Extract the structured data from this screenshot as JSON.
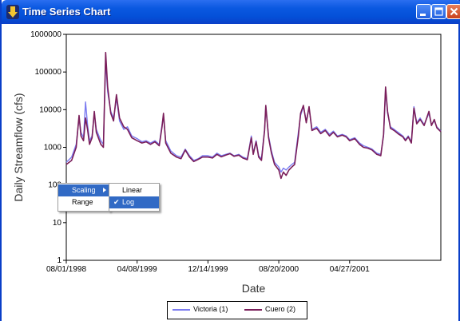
{
  "window": {
    "title": "Time Series Chart"
  },
  "icons": [
    "download-arrow-icon",
    "minimize-icon",
    "maximize-icon",
    "close-icon"
  ],
  "colors": {
    "titlebar": "#0a58e0",
    "victoria": "#7b7bf0",
    "cuero": "#7a1e5a",
    "menu_highlight": "#316ac5"
  },
  "context_menu": {
    "items": [
      {
        "label": "Scaling",
        "highlighted": true,
        "has_submenu": true
      },
      {
        "label": "Range",
        "highlighted": false
      }
    ],
    "submenu": {
      "items": [
        {
          "label": "Linear",
          "checked": false,
          "highlighted": false
        },
        {
          "label": "Log",
          "checked": true,
          "highlighted": true
        }
      ]
    }
  },
  "chart_data": {
    "type": "line",
    "xlabel": "Date",
    "ylabel": "Daily Streamflow (cfs)",
    "yscale": "log",
    "ylim": [
      1,
      1000000
    ],
    "y_ticks": [
      "1",
      "10",
      "100",
      "1000",
      "10000",
      "100000",
      "1000000"
    ],
    "x_ticks": [
      "08/01/1998",
      "04/08/1999",
      "12/14/1999",
      "08/20/2000",
      "04/27/2001"
    ],
    "x_range": [
      "1998-08-01",
      "2002-03-15"
    ],
    "legend_position": "bottom",
    "series": [
      {
        "name": "Victoria (1)",
        "color": "#7b7bf0",
        "points": [
          [
            "1998-08-01",
            400
          ],
          [
            "1998-08-20",
            550
          ],
          [
            "1998-09-05",
            1200
          ],
          [
            "1998-09-15",
            6000
          ],
          [
            "1998-09-22",
            2500
          ],
          [
            "1998-10-01",
            1800
          ],
          [
            "1998-10-08",
            16000
          ],
          [
            "1998-10-15",
            4000
          ],
          [
            "1998-10-22",
            1500
          ],
          [
            "1998-10-31",
            2000
          ],
          [
            "1998-11-08",
            8000
          ],
          [
            "1998-11-15",
            3000
          ],
          [
            "1998-12-01",
            1500
          ],
          [
            "1998-12-10",
            1200
          ],
          [
            "1998-12-18",
            200000
          ],
          [
            "1998-12-25",
            30000
          ],
          [
            "1999-01-05",
            9000
          ],
          [
            "1999-01-15",
            6000
          ],
          [
            "1999-01-25",
            20000
          ],
          [
            "1999-02-05",
            5000
          ],
          [
            "1999-02-20",
            3000
          ],
          [
            "1999-03-05",
            3500
          ],
          [
            "1999-03-20",
            2000
          ],
          [
            "1999-04-08",
            1700
          ],
          [
            "1999-04-25",
            1400
          ],
          [
            "1999-05-10",
            1500
          ],
          [
            "1999-05-25",
            1300
          ],
          [
            "1999-06-10",
            1500
          ],
          [
            "1999-06-25",
            1200
          ],
          [
            "1999-07-05",
            4000
          ],
          [
            "1999-07-10",
            7000
          ],
          [
            "1999-07-18",
            1500
          ],
          [
            "1999-08-05",
            800
          ],
          [
            "1999-08-25",
            600
          ],
          [
            "1999-09-10",
            550
          ],
          [
            "1999-09-25",
            900
          ],
          [
            "1999-10-10",
            600
          ],
          [
            "1999-10-25",
            450
          ],
          [
            "1999-11-10",
            500
          ],
          [
            "1999-11-25",
            600
          ],
          [
            "1999-12-14",
            600
          ],
          [
            "1999-12-30",
            550
          ],
          [
            "2000-01-15",
            700
          ],
          [
            "2000-01-30",
            600
          ],
          [
            "2000-02-15",
            650
          ],
          [
            "2000-03-01",
            700
          ],
          [
            "2000-03-15",
            600
          ],
          [
            "2000-04-01",
            650
          ],
          [
            "2000-04-15",
            550
          ],
          [
            "2000-05-01",
            500
          ],
          [
            "2000-05-15",
            2000
          ],
          [
            "2000-05-22",
            700
          ],
          [
            "2000-06-01",
            1500
          ],
          [
            "2000-06-10",
            600
          ],
          [
            "2000-06-20",
            500
          ],
          [
            "2000-07-01",
            3000
          ],
          [
            "2000-07-05",
            12000
          ],
          [
            "2000-07-15",
            2000
          ],
          [
            "2000-07-25",
            800
          ],
          [
            "2000-08-05",
            400
          ],
          [
            "2000-08-20",
            300
          ],
          [
            "2000-08-28",
            220
          ],
          [
            "2000-09-05",
            280
          ],
          [
            "2000-09-15",
            250
          ],
          [
            "2000-09-25",
            300
          ],
          [
            "2000-10-05",
            350
          ],
          [
            "2000-10-15",
            400
          ],
          [
            "2000-10-28",
            2500
          ],
          [
            "2000-11-05",
            7000
          ],
          [
            "2000-11-15",
            12000
          ],
          [
            "2000-11-25",
            5000
          ],
          [
            "2000-12-05",
            11000
          ],
          [
            "2000-12-15",
            3000
          ],
          [
            "2001-01-01",
            3500
          ],
          [
            "2001-01-15",
            2500
          ],
          [
            "2001-01-31",
            3000
          ],
          [
            "2001-02-15",
            2200
          ],
          [
            "2001-03-01",
            2700
          ],
          [
            "2001-03-15",
            2000
          ],
          [
            "2001-04-01",
            2200
          ],
          [
            "2001-04-15",
            2000
          ],
          [
            "2001-04-27",
            1600
          ],
          [
            "2001-05-15",
            1800
          ],
          [
            "2001-06-01",
            1300
          ],
          [
            "2001-06-15",
            1100
          ],
          [
            "2001-07-01",
            1000
          ],
          [
            "2001-07-15",
            900
          ],
          [
            "2001-08-01",
            700
          ],
          [
            "2001-08-15",
            650
          ],
          [
            "2001-08-25",
            2000
          ],
          [
            "2001-09-01",
            35000
          ],
          [
            "2001-09-08",
            8000
          ],
          [
            "2001-09-18",
            3500
          ],
          [
            "2001-10-01",
            3000
          ],
          [
            "2001-10-15",
            2500
          ],
          [
            "2001-11-01",
            2000
          ],
          [
            "2001-11-10",
            1600
          ],
          [
            "2001-11-20",
            2000
          ],
          [
            "2001-12-01",
            1400
          ],
          [
            "2001-12-10",
            12000
          ],
          [
            "2001-12-20",
            4500
          ],
          [
            "2002-01-01",
            6000
          ],
          [
            "2002-01-15",
            4000
          ],
          [
            "2002-02-01",
            8000
          ],
          [
            "2002-02-10",
            4000
          ],
          [
            "2002-02-20",
            5000
          ],
          [
            "2002-03-01",
            3500
          ],
          [
            "2002-03-15",
            2700
          ]
        ]
      },
      {
        "name": "Cuero (2)",
        "color": "#7a1e5a",
        "points": [
          [
            "1998-08-01",
            350
          ],
          [
            "1998-08-20",
            450
          ],
          [
            "1998-09-05",
            1000
          ],
          [
            "1998-09-15",
            7000
          ],
          [
            "1998-09-22",
            2000
          ],
          [
            "1998-10-01",
            1500
          ],
          [
            "1998-10-08",
            6000
          ],
          [
            "1998-10-15",
            3000
          ],
          [
            "1998-10-22",
            1200
          ],
          [
            "1998-10-31",
            1800
          ],
          [
            "1998-11-08",
            9000
          ],
          [
            "1998-11-15",
            2500
          ],
          [
            "1998-12-01",
            1200
          ],
          [
            "1998-12-10",
            1000
          ],
          [
            "1998-12-18",
            330000
          ],
          [
            "1998-12-25",
            40000
          ],
          [
            "1999-01-05",
            8000
          ],
          [
            "1999-01-15",
            5000
          ],
          [
            "1999-01-25",
            25000
          ],
          [
            "1999-02-05",
            6000
          ],
          [
            "1999-02-20",
            3500
          ],
          [
            "1999-03-05",
            3000
          ],
          [
            "1999-03-20",
            1800
          ],
          [
            "1999-04-08",
            1500
          ],
          [
            "1999-04-25",
            1300
          ],
          [
            "1999-05-10",
            1400
          ],
          [
            "1999-05-25",
            1200
          ],
          [
            "1999-06-10",
            1400
          ],
          [
            "1999-06-25",
            1100
          ],
          [
            "1999-07-05",
            3500
          ],
          [
            "1999-07-10",
            8000
          ],
          [
            "1999-07-18",
            1300
          ],
          [
            "1999-08-05",
            700
          ],
          [
            "1999-08-25",
            550
          ],
          [
            "1999-09-10",
            500
          ],
          [
            "1999-09-25",
            850
          ],
          [
            "1999-10-10",
            550
          ],
          [
            "1999-10-25",
            420
          ],
          [
            "1999-11-10",
            480
          ],
          [
            "1999-11-25",
            550
          ],
          [
            "1999-12-14",
            550
          ],
          [
            "1999-12-30",
            520
          ],
          [
            "2000-01-15",
            650
          ],
          [
            "2000-01-30",
            560
          ],
          [
            "2000-02-15",
            620
          ],
          [
            "2000-03-01",
            680
          ],
          [
            "2000-03-15",
            580
          ],
          [
            "2000-04-01",
            620
          ],
          [
            "2000-04-15",
            520
          ],
          [
            "2000-05-01",
            470
          ],
          [
            "2000-05-15",
            1800
          ],
          [
            "2000-05-22",
            650
          ],
          [
            "2000-06-01",
            1400
          ],
          [
            "2000-06-10",
            550
          ],
          [
            "2000-06-20",
            450
          ],
          [
            "2000-07-01",
            2800
          ],
          [
            "2000-07-05",
            13000
          ],
          [
            "2000-07-15",
            1800
          ],
          [
            "2000-07-25",
            700
          ],
          [
            "2000-08-05",
            350
          ],
          [
            "2000-08-20",
            250
          ],
          [
            "2000-08-28",
            150
          ],
          [
            "2000-09-05",
            220
          ],
          [
            "2000-09-15",
            180
          ],
          [
            "2000-09-25",
            250
          ],
          [
            "2000-10-05",
            300
          ],
          [
            "2000-10-15",
            350
          ],
          [
            "2000-10-28",
            2000
          ],
          [
            "2000-11-05",
            8000
          ],
          [
            "2000-11-15",
            13000
          ],
          [
            "2000-11-25",
            4500
          ],
          [
            "2000-12-05",
            12000
          ],
          [
            "2000-12-15",
            2800
          ],
          [
            "2001-01-01",
            3200
          ],
          [
            "2001-01-15",
            2300
          ],
          [
            "2001-01-31",
            2800
          ],
          [
            "2001-02-15",
            2000
          ],
          [
            "2001-03-01",
            2500
          ],
          [
            "2001-03-15",
            1900
          ],
          [
            "2001-04-01",
            2100
          ],
          [
            "2001-04-15",
            1900
          ],
          [
            "2001-04-27",
            1500
          ],
          [
            "2001-05-15",
            1700
          ],
          [
            "2001-06-01",
            1200
          ],
          [
            "2001-06-15",
            1000
          ],
          [
            "2001-07-01",
            950
          ],
          [
            "2001-07-15",
            850
          ],
          [
            "2001-08-01",
            650
          ],
          [
            "2001-08-15",
            600
          ],
          [
            "2001-08-25",
            2200
          ],
          [
            "2001-09-01",
            40000
          ],
          [
            "2001-09-08",
            9000
          ],
          [
            "2001-09-18",
            3200
          ],
          [
            "2001-10-01",
            2800
          ],
          [
            "2001-10-15",
            2300
          ],
          [
            "2001-11-01",
            1900
          ],
          [
            "2001-11-10",
            1500
          ],
          [
            "2001-11-20",
            1900
          ],
          [
            "2001-12-01",
            1300
          ],
          [
            "2001-12-10",
            11000
          ],
          [
            "2001-12-20",
            4200
          ],
          [
            "2002-01-01",
            5500
          ],
          [
            "2002-01-15",
            3800
          ],
          [
            "2002-02-01",
            9000
          ],
          [
            "2002-02-10",
            3800
          ],
          [
            "2002-02-20",
            5500
          ],
          [
            "2002-03-01",
            3300
          ],
          [
            "2002-03-15",
            2600
          ]
        ]
      }
    ]
  }
}
